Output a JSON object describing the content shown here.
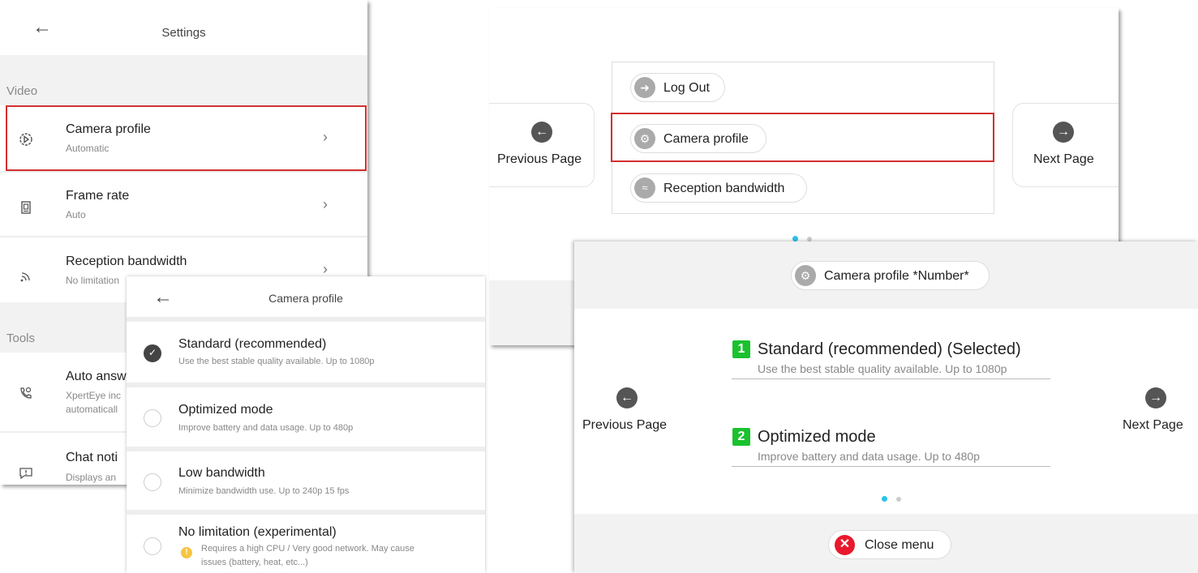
{
  "colors": {
    "highlight_red": "#d32f2f",
    "badge_green": "#19c22e",
    "dot_active": "#2bc4e8",
    "close_red": "#e8192c"
  },
  "settings": {
    "title": "Settings",
    "section_video": "Video",
    "section_tools": "Tools",
    "rows": [
      {
        "icon": "camera-profile-icon",
        "title": "Camera profile",
        "subtitle": "Automatic"
      },
      {
        "icon": "frame-rate-icon",
        "title": "Frame rate",
        "subtitle": "Auto"
      },
      {
        "icon": "bandwidth-icon",
        "title": "Reception bandwidth",
        "subtitle": "No limitation"
      },
      {
        "icon": "auto-answer-icon",
        "title": "Auto answ",
        "subtitle_line1": "XpertEye inc",
        "subtitle_line2": "automaticall"
      },
      {
        "icon": "chat-notification-icon",
        "title": "Chat noti",
        "subtitle": "Displays an"
      }
    ]
  },
  "camera_profile": {
    "title": "Camera profile",
    "options": [
      {
        "title": "Standard (recommended)",
        "subtitle": "Use the best stable quality available. Up to 1080p",
        "checked": true
      },
      {
        "title": "Optimized mode",
        "subtitle": "Improve battery and data usage. Up to 480p",
        "checked": false
      },
      {
        "title": "Low bandwidth",
        "subtitle": "Minimize bandwidth use. Up to 240p 15 fps",
        "checked": false
      },
      {
        "title": "No limitation (experimental)",
        "subtitle_line1": "Requires a high CPU / Very good network. May cause",
        "subtitle_line2": "issues (battery, heat, etc...)",
        "checked": false,
        "warning_icon": "warning-icon"
      }
    ]
  },
  "menu": {
    "previous_page": "Previous Page",
    "next_page": "Next Page",
    "items": [
      {
        "icon": "logout-icon",
        "label": "Log Out"
      },
      {
        "icon": "camera-settings-icon",
        "label": "Camera profile"
      },
      {
        "icon": "wifi-icon",
        "label": "Reception bandwidth"
      }
    ],
    "page_dots": 2,
    "active_page": 1
  },
  "number_menu": {
    "header_label": "Camera profile *Number*",
    "previous_page": "Previous Page",
    "next_page": "Next Page",
    "options": [
      {
        "number": "1",
        "title": "Standard (recommended) (Selected)",
        "subtitle": "Use the best stable quality available. Up to 1080p"
      },
      {
        "number": "2",
        "title": "Optimized mode",
        "subtitle": "Improve battery and data usage. Up to 480p"
      }
    ],
    "close_label": "Close menu"
  }
}
